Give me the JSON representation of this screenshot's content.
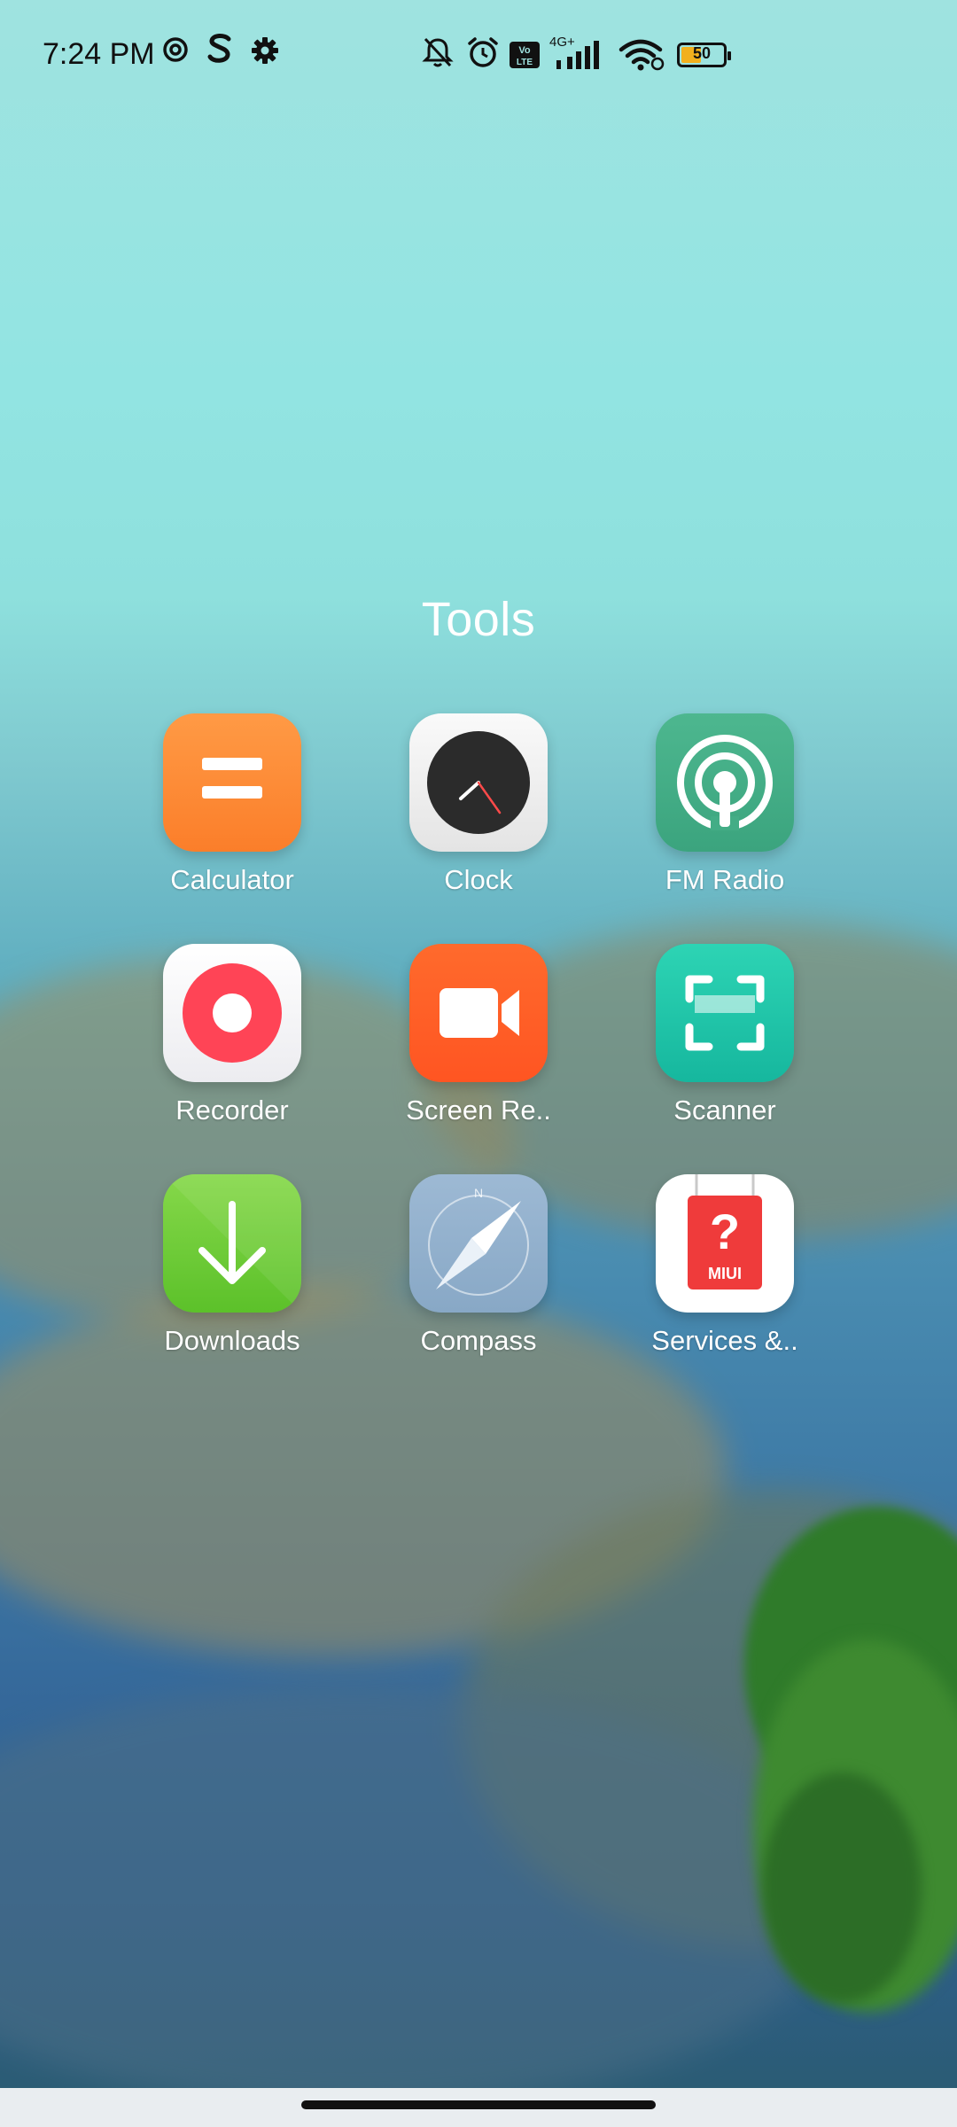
{
  "status_bar": {
    "time": "7:24 PM",
    "left_icons": [
      "at-sign-icon",
      "s-icon",
      "gear-icon"
    ],
    "right_icons": [
      "bell-off-icon",
      "alarm-icon",
      "volte-icon",
      "signal-4g-icon",
      "wifi-icon",
      "battery-icon"
    ],
    "network_label": "4G+",
    "volte_label": "Vo LTE",
    "battery_level": "50",
    "battery_color": "#f2b01e"
  },
  "folder": {
    "title": "Tools",
    "apps": [
      {
        "label": "Calculator",
        "icon": "calculator-icon",
        "color": "#fb8a34"
      },
      {
        "label": "Clock",
        "icon": "clock-icon",
        "color": "#f2f2f2"
      },
      {
        "label": "FM Radio",
        "icon": "radio-icon",
        "color": "#43ad86"
      },
      {
        "label": "Recorder",
        "icon": "recorder-icon",
        "color": "#ff4456"
      },
      {
        "label": "Screen Re..",
        "icon": "screen-recorder-icon",
        "color": "#ff5e26"
      },
      {
        "label": "Scanner",
        "icon": "scanner-icon",
        "color": "#1ec6a8"
      },
      {
        "label": "Downloads",
        "icon": "download-icon",
        "color": "#70cc38"
      },
      {
        "label": "Compass",
        "icon": "compass-icon",
        "color": "#93b1cd"
      },
      {
        "label": "Services &..",
        "icon": "services-feedback-icon",
        "color": "#ef3b3b",
        "badge_text": "MIUI"
      }
    ]
  }
}
